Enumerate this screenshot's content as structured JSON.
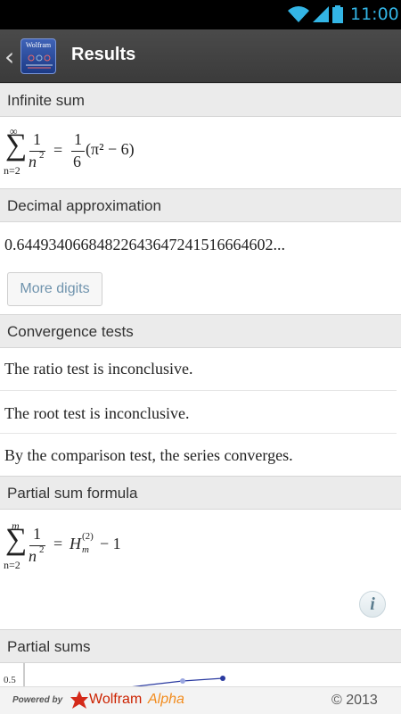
{
  "status_bar": {
    "time": "11:00",
    "icons": [
      "wifi-icon",
      "signal-icon",
      "battery-icon"
    ],
    "accent": "#33b5e5"
  },
  "action_bar": {
    "title": "Results",
    "app_icon_text": "Wolfram",
    "back_icon": "chevron-left-icon"
  },
  "pods": {
    "infinite_sum": {
      "title": "Infinite sum",
      "formula": {
        "upper": "∞",
        "lower": "n=2",
        "num": "1",
        "den": "n",
        "exp": "2",
        "eq": "=",
        "coef_num": "1",
        "coef_den": "6",
        "expr": "(π² − 6)"
      }
    },
    "decimal": {
      "title": "Decimal approximation",
      "value": "0.64493406684822643647241516664602...",
      "button": "More digits"
    },
    "convergence": {
      "title": "Convergence tests",
      "lines": [
        "The ratio test is inconclusive.",
        "The root test is inconclusive.",
        "By the comparison test, the series converges."
      ]
    },
    "partial_formula": {
      "title": "Partial sum formula",
      "formula": {
        "upper": "m",
        "lower": "n=2",
        "num": "1",
        "den": "n",
        "exp": "2",
        "eq": "=",
        "H": "H",
        "sup": "(2)",
        "sub": "m",
        "rest": "− 1"
      },
      "info_icon": "info-icon"
    },
    "partial_sums": {
      "title": "Partial sums",
      "tick": "0.5"
    }
  },
  "footer": {
    "powered": "Powered by",
    "brand_a": "Wolfram",
    "brand_b": "Alpha",
    "copyright": "© 2013"
  }
}
